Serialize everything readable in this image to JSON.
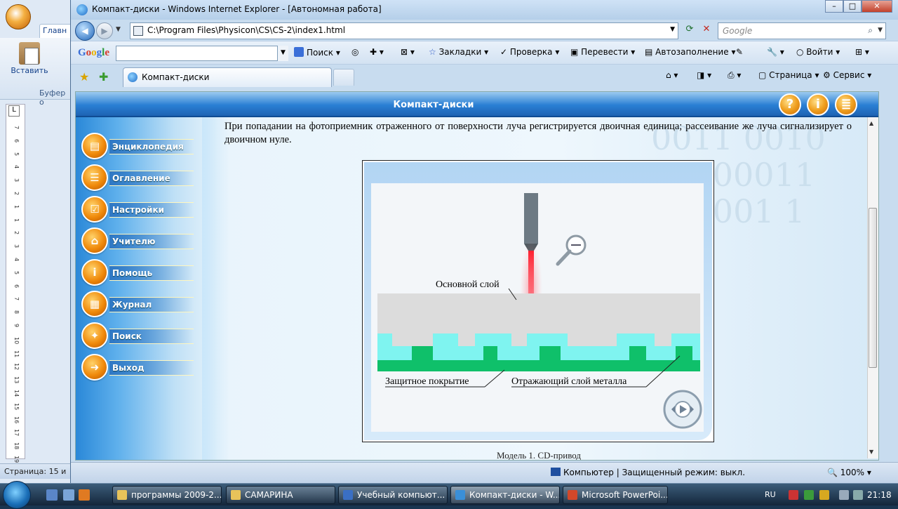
{
  "word": {
    "tab_home": "Главн",
    "paste_label": "Вставить",
    "buffer_label": "Буфер о",
    "status_page": "Страница: 15 и",
    "ruler_numbers": [
      "7",
      "6",
      "5",
      "4",
      "3",
      "2",
      "1",
      "1",
      "2",
      "3",
      "4",
      "5",
      "6",
      "7",
      "8",
      "9",
      "10",
      "11",
      "12",
      "13",
      "14",
      "15",
      "16",
      "17",
      "18",
      "19"
    ]
  },
  "ie": {
    "window_title": "Компакт-диски - Windows Internet Explorer - [Автономная работа]",
    "address": "C:\\Program Files\\Physicon\\CS\\CS-2\\index1.html",
    "search_placeholder": "Google",
    "google_toolbar": {
      "logo": "Google",
      "search_btn": "Поиск",
      "bookmarks": "Закладки",
      "check": "Проверка",
      "translate": "Перевести",
      "autofill": "Автозаполнение",
      "login": "Войти"
    },
    "tab_title": "Компакт-диски",
    "commands": {
      "page": "Страница",
      "service": "Сервис"
    },
    "status": {
      "zone": "Компьютер | Защищенный режим: выкл.",
      "zoom": "100%"
    }
  },
  "app": {
    "title": "Компакт-диски",
    "header_buttons": [
      "?",
      "i",
      "≣"
    ],
    "menu": [
      {
        "label": "Энциклопедия",
        "glyph": "▤"
      },
      {
        "label": "Оглавление",
        "glyph": "☰"
      },
      {
        "label": "Настройки",
        "glyph": "☑"
      },
      {
        "label": "Учителю",
        "glyph": "⌂"
      },
      {
        "label": "Помощь",
        "glyph": "i"
      },
      {
        "label": "Журнал",
        "glyph": "▦"
      },
      {
        "label": "Поиск",
        "glyph": "✦"
      },
      {
        "label": "Выход",
        "glyph": "➜"
      }
    ],
    "paragraph": "При попадании на фотоприемник отраженного от поверхности луча регистрируется двоичная единица; рассеивание же луча сигнализирует о двоичном нуле.",
    "figure": {
      "label_base": "Основной слой",
      "label_protect": "Защитное покрытие",
      "label_metal": "Отражающий слой металла",
      "caption": "Модель 1. CD-привод"
    },
    "binary_bg": "0011 0010\n1 0 00011\n001001 1"
  },
  "taskbar": {
    "buttons": [
      {
        "label": "программы 2009-2...",
        "icon_color": "#e8c35a"
      },
      {
        "label": "САМАРИНА",
        "icon_color": "#e8c35a"
      },
      {
        "label": "Учебный компьют...",
        "icon_color": "#3a6fc4"
      },
      {
        "label": "Компакт-диски - W...",
        "icon_color": "#3a8fd8"
      },
      {
        "label": "Microsoft PowerPoi...",
        "icon_color": "#d2482a"
      }
    ],
    "lang": "RU",
    "time": "21:18"
  }
}
